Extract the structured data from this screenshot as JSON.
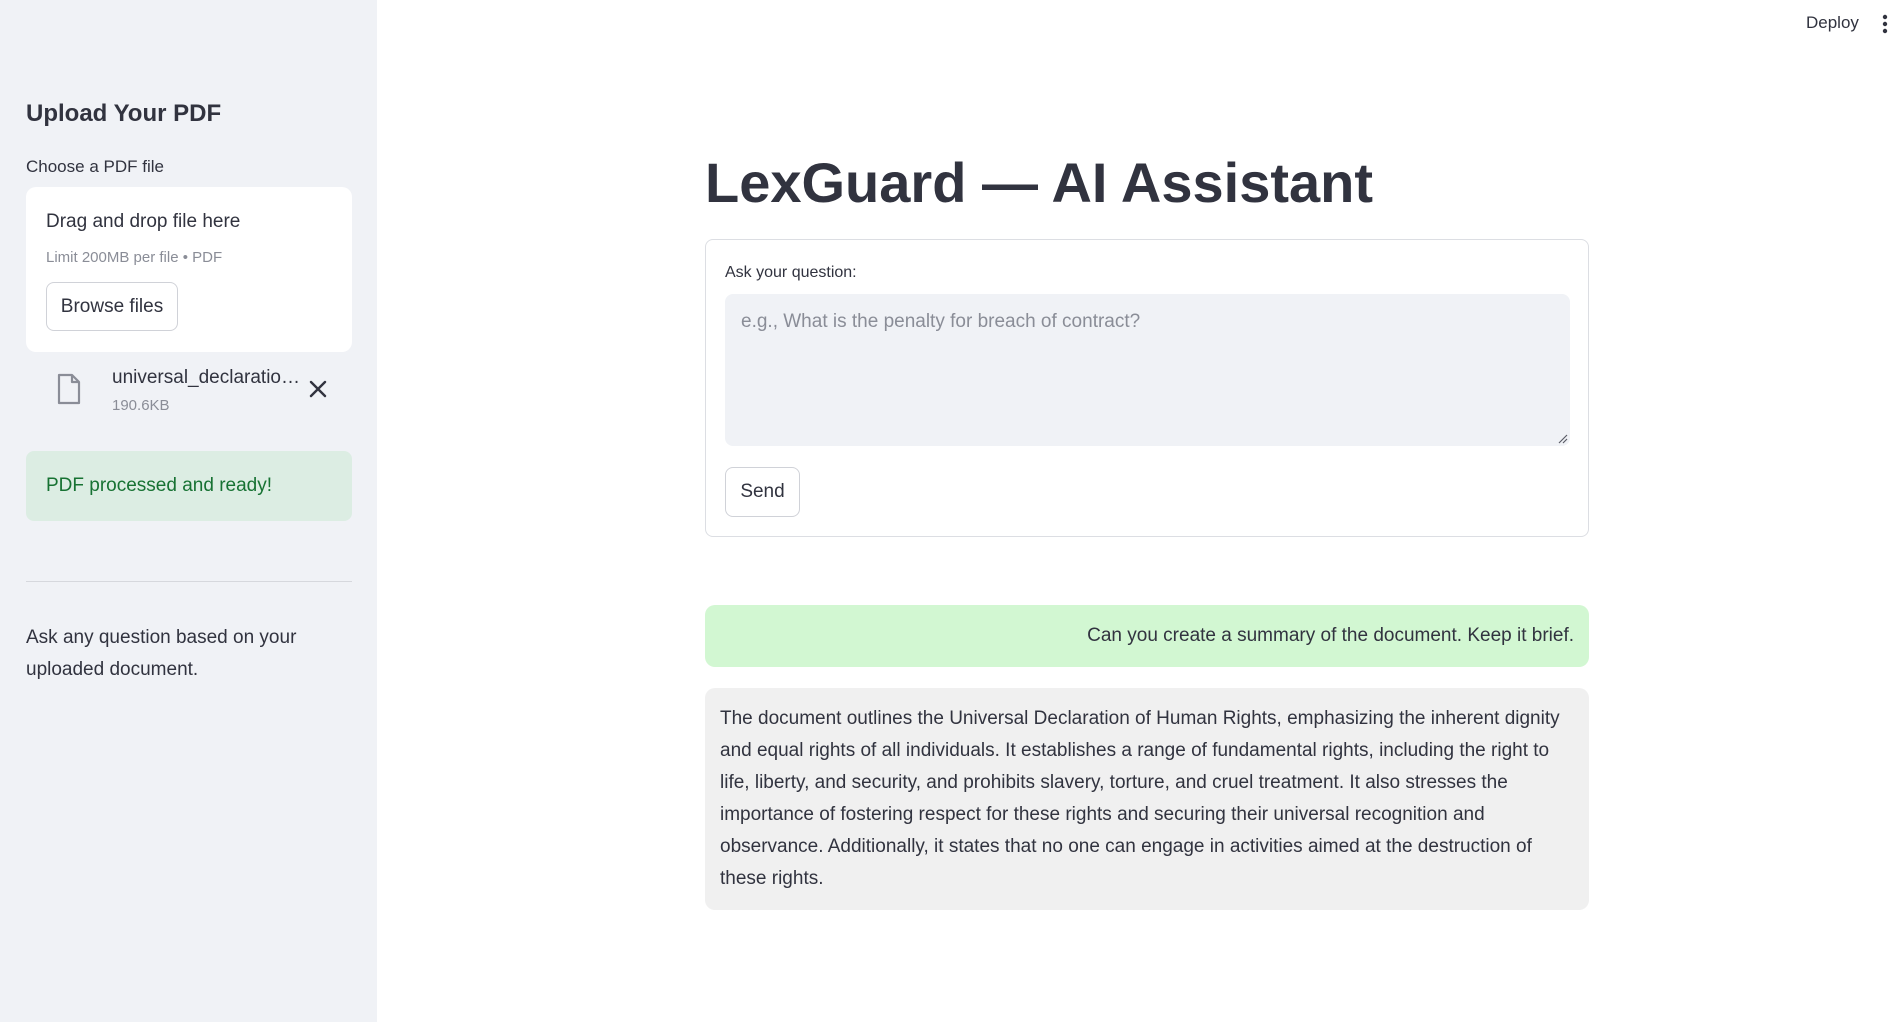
{
  "sidebar": {
    "title": "Upload Your PDF",
    "choose_label": "Choose a PDF file",
    "dropzone": {
      "main_text": "Drag and drop file here",
      "limit_text": "Limit 200MB per file • PDF",
      "browse_label": "Browse files"
    },
    "file": {
      "name": "universal_declaratio…",
      "size": "190.6KB",
      "icon": "file-icon",
      "remove_icon": "close-icon"
    },
    "status_message": "PDF processed and ready!",
    "help_text": "Ask any question based on your uploaded document."
  },
  "header": {
    "deploy_label": "Deploy",
    "menu_icon": "more-vertical-icon"
  },
  "main": {
    "title": "LexGuard — AI Assistant",
    "form": {
      "question_label": "Ask your question:",
      "question_value": "",
      "question_placeholder": "e.g., What is the penalty for breach of contract?",
      "send_label": "Send"
    },
    "chat": {
      "user_message": "Can you create a summary of the document. Keep it brief.",
      "assistant_message": "The document outlines the Universal Declaration of Human Rights, emphasizing the inherent dignity and equal rights of all individuals. It establishes a range of fundamental rights, including the right to life, liberty, and security, and prohibits slavery, torture, and cruel treatment. It also stresses the importance of fostering respect for these rights and securing their universal recognition and observance. Additionally, it states that no one can engage in activities aimed at the destruction of these rights."
    }
  },
  "colors": {
    "sidebar_bg": "#f0f2f6",
    "success_bg": "#dcede3",
    "success_text": "#177233",
    "user_bubble_bg": "#d2f7d2",
    "assistant_bubble_bg": "#f0f0f0",
    "text": "#31333f"
  }
}
